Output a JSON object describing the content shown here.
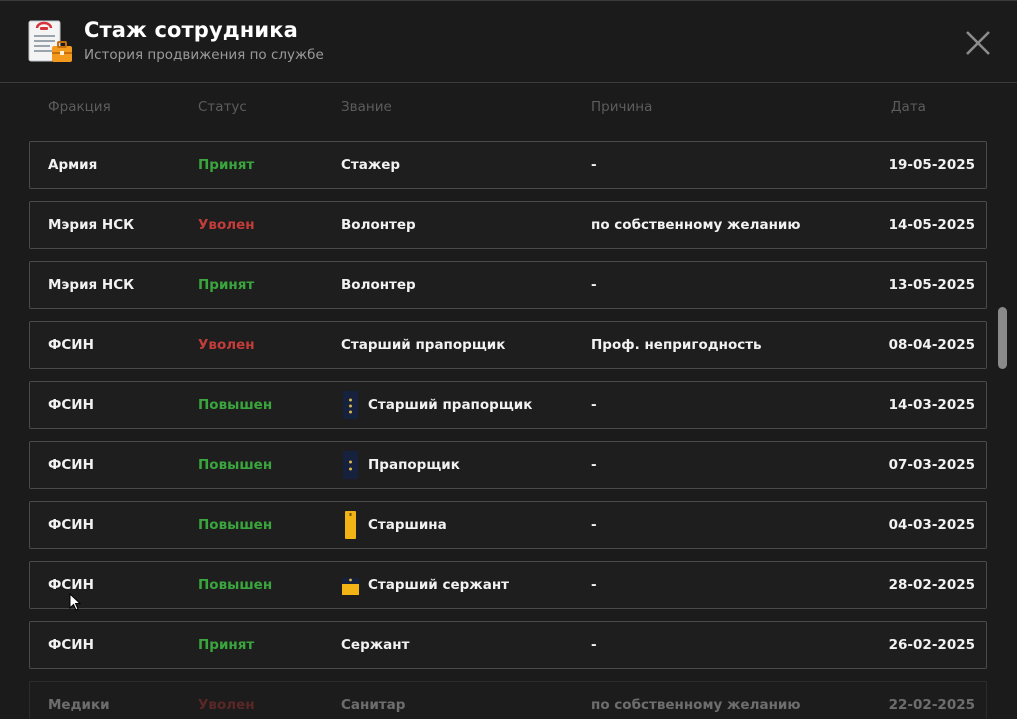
{
  "header": {
    "title": "Стаж сотрудника",
    "subtitle": "История продвижения по службе",
    "icon": "document-briefcase-icon",
    "close_icon": "close-icon"
  },
  "columns": {
    "faction": "Фракция",
    "status": "Статус",
    "rank": "Звание",
    "reason": "Причина",
    "date": "Дата"
  },
  "colors": {
    "hired": "#3aa53d",
    "fired": "#c23c3a",
    "promoted": "#3aa53d",
    "background": "#1b1b1b",
    "row_border": "#4a4a4a"
  },
  "rows": [
    {
      "faction": "Армия",
      "status": "Принят",
      "status_type": "green",
      "rank": "Стажер",
      "insignia": "",
      "reason": "-",
      "date": "19-05-2025"
    },
    {
      "faction": "Мэрия НСК",
      "status": "Уволен",
      "status_type": "red",
      "rank": "Волонтер",
      "insignia": "",
      "reason": "по собственному желанию",
      "date": "14-05-2025"
    },
    {
      "faction": "Мэрия НСК",
      "status": "Принят",
      "status_type": "green",
      "rank": "Волонтер",
      "insignia": "",
      "reason": "-",
      "date": "13-05-2025"
    },
    {
      "faction": "ФСИН",
      "status": "Уволен",
      "status_type": "red",
      "rank": "Старший прапорщик",
      "insignia": "",
      "reason": "Проф. непригодность",
      "date": "08-04-2025"
    },
    {
      "faction": "ФСИН",
      "status": "Повышен",
      "status_type": "green",
      "rank": "Старший прапорщик",
      "insignia": "senior-warrant-officer-insignia-icon",
      "reason": "-",
      "date": "14-03-2025"
    },
    {
      "faction": "ФСИН",
      "status": "Повышен",
      "status_type": "green",
      "rank": "Прапорщик",
      "insignia": "warrant-officer-insignia-icon",
      "reason": "-",
      "date": "07-03-2025"
    },
    {
      "faction": "ФСИН",
      "status": "Повышен",
      "status_type": "green",
      "rank": "Старшина",
      "insignia": "sergeant-major-insignia-icon",
      "reason": "-",
      "date": "04-03-2025"
    },
    {
      "faction": "ФСИН",
      "status": "Повышен",
      "status_type": "green",
      "rank": "Старший сержант",
      "insignia": "senior-sergeant-insignia-icon",
      "reason": "-",
      "date": "28-02-2025"
    },
    {
      "faction": "ФСИН",
      "status": "Принят",
      "status_type": "green",
      "rank": "Сержант",
      "insignia": "",
      "reason": "-",
      "date": "26-02-2025"
    },
    {
      "faction": "Медики",
      "status": "Уволен",
      "status_type": "red",
      "rank": "Санитар",
      "insignia": "",
      "reason": "по собственному желанию",
      "date": "22-02-2025"
    }
  ]
}
